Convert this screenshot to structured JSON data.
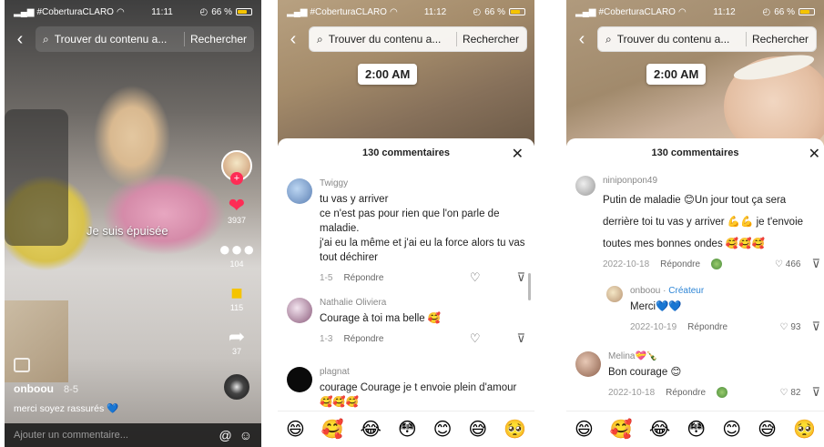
{
  "status": {
    "carrier": "#CoberturaCLARO",
    "time_p1": "11:11",
    "time_p2": "11:12",
    "time_p3": "11:12",
    "battery": "66 %"
  },
  "search": {
    "placeholder": "Trouver du contenu a...",
    "button": "Rechercher"
  },
  "phone1": {
    "caption": "Je suis épuisée",
    "likes": "3937",
    "comments": "104",
    "saves": "115",
    "shares": "37",
    "handle": "onboou",
    "date": "8-5",
    "description": "merci soyez rassurés 💙",
    "add_comment": "Ajouter un commentaire..."
  },
  "time_badge": "2:00 AM",
  "comments_header": "130 commentaires",
  "phone2": {
    "comments": [
      {
        "name": "Twiggy",
        "text": "tu vas y arriver\nce n'est pas pour rien que l'on parle de maladie.\nj'ai eu la même et j'ai eu la force alors tu vas tout déchirer",
        "date": "1-5",
        "reply": "Répondre"
      },
      {
        "name": "Nathalie Oliviera",
        "text": "Courage à toi ma belle 🥰",
        "date": "1-3",
        "reply": "Répondre"
      },
      {
        "name": "plagnat",
        "text": "courage Courage je t envoie plein d'amour 🥰🥰🥰",
        "date": "",
        "reply": ""
      }
    ]
  },
  "phone3": {
    "comments": [
      {
        "name": "niniponpon49",
        "text": "Putin de maladie 😊Un jour tout ça sera derrière toi tu vas y arriver 💪💪 je t'envoie toutes mes bonnes ondes 🥰🥰🥰",
        "date": "2022-10-18",
        "reply": "Répondre",
        "likes": "466"
      },
      {
        "name": "onboou",
        "badge": "Créateur",
        "text": "Merci💙💙",
        "date": "2022-10-19",
        "reply": "Répondre",
        "likes": "93"
      },
      {
        "name": "Melina💝🍾",
        "text": "Bon courage 😊",
        "date": "2022-10-18",
        "reply": "Répondre",
        "likes": "82"
      }
    ]
  },
  "emojis": [
    "😄",
    "🥰",
    "😂",
    "😳",
    "😊",
    "😅",
    "🥺"
  ],
  "colors": {
    "like_red": "#fe2c55",
    "bookmark_yellow": "#f5c400",
    "creator_blue": "#2f86d6"
  },
  "icons": {
    "back": "chevron-left-icon",
    "search": "search-icon",
    "close": "close-icon",
    "heart": "heart-icon",
    "dislike": "thumbs-down-icon",
    "at": "at-icon",
    "emoji": "smiley-icon"
  }
}
